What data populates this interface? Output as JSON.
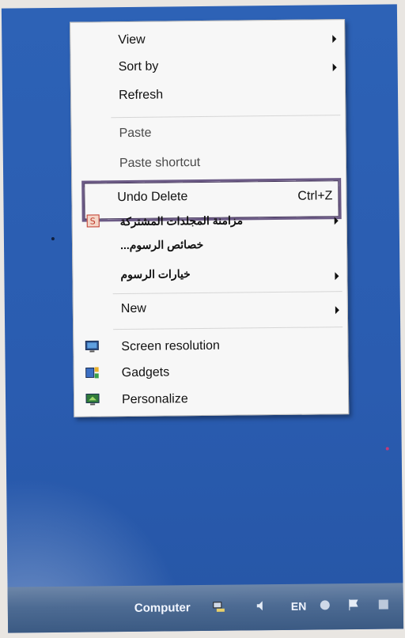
{
  "context_menu": {
    "items": [
      {
        "label": "View",
        "has_submenu": true
      },
      {
        "label": "Sort by",
        "has_submenu": true
      },
      {
        "label": "Refresh",
        "has_submenu": false
      },
      {
        "label": "Paste",
        "has_submenu": false
      },
      {
        "label": "Paste shortcut",
        "has_submenu": false
      },
      {
        "label": "Undo Delete",
        "shortcut": "Ctrl+Z",
        "has_submenu": false
      },
      {
        "label": "مزامنة المجلدات المشتركة",
        "has_submenu": true,
        "icon": "sync-icon"
      },
      {
        "label": "خصائص الرسوم...",
        "has_submenu": false
      },
      {
        "label": "خيارات الرسوم",
        "has_submenu": true
      },
      {
        "label": "New",
        "has_submenu": true
      },
      {
        "label": "Screen resolution",
        "has_submenu": false,
        "icon": "monitor-icon"
      },
      {
        "label": "Gadgets",
        "has_submenu": false,
        "icon": "gadgets-icon"
      },
      {
        "label": "Personalize",
        "has_submenu": false,
        "icon": "personalize-icon"
      }
    ]
  },
  "taskbar": {
    "computer_label": "Computer",
    "language": "EN"
  }
}
